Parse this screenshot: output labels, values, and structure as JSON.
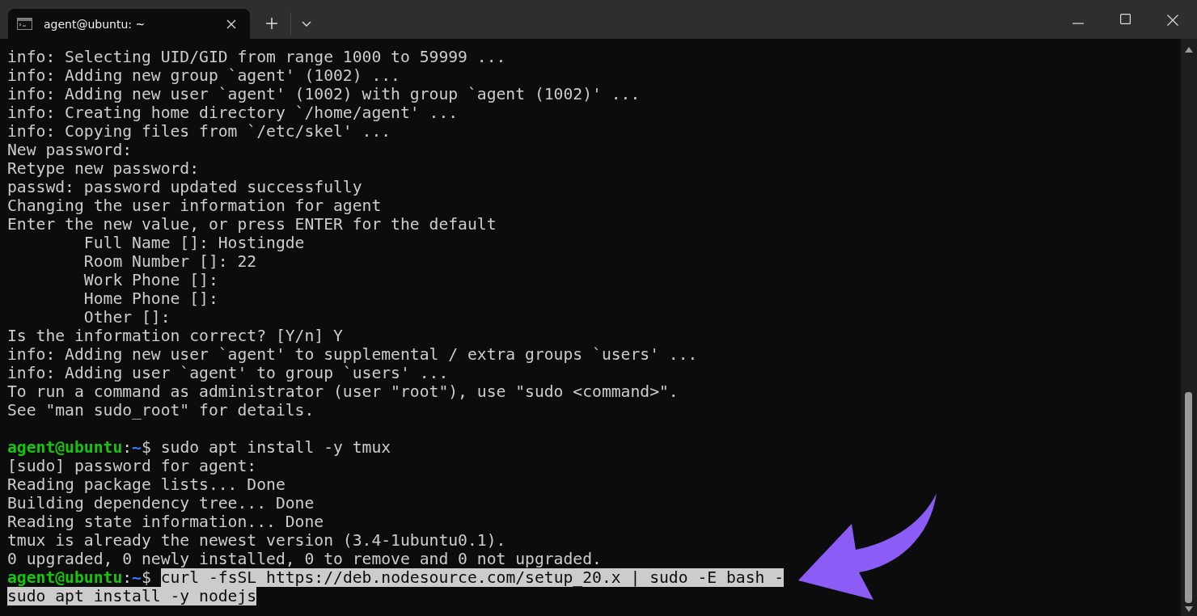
{
  "tab": {
    "title": "agent@ubuntu: ~",
    "selected": true
  },
  "lines": [
    {
      "kind": "text",
      "text": "info: Selecting UID/GID from range 1000 to 59999 ...",
      "selected": false
    },
    {
      "kind": "text",
      "text": "info: Adding new group `agent' (1002) ...",
      "selected": false
    },
    {
      "kind": "text",
      "text": "info: Adding new user `agent' (1002) with group `agent (1002)' ...",
      "selected": false
    },
    {
      "kind": "text",
      "text": "info: Creating home directory `/home/agent' ...",
      "selected": false
    },
    {
      "kind": "text",
      "text": "info: Copying files from `/etc/skel' ...",
      "selected": false
    },
    {
      "kind": "text",
      "text": "New password:",
      "selected": false
    },
    {
      "kind": "text",
      "text": "Retype new password:",
      "selected": false
    },
    {
      "kind": "text",
      "text": "passwd: password updated successfully",
      "selected": false
    },
    {
      "kind": "text",
      "text": "Changing the user information for agent",
      "selected": false
    },
    {
      "kind": "text",
      "text": "Enter the new value, or press ENTER for the default",
      "selected": false
    },
    {
      "kind": "text",
      "text": "        Full Name []: Hostingde",
      "selected": false
    },
    {
      "kind": "text",
      "text": "        Room Number []: 22",
      "selected": false
    },
    {
      "kind": "text",
      "text": "        Work Phone []:",
      "selected": false
    },
    {
      "kind": "text",
      "text": "        Home Phone []:",
      "selected": false
    },
    {
      "kind": "text",
      "text": "        Other []:",
      "selected": false
    },
    {
      "kind": "text",
      "text": "Is the information correct? [Y/n] Y",
      "selected": false
    },
    {
      "kind": "text",
      "text": "info: Adding new user `agent' to supplemental / extra groups `users' ...",
      "selected": false
    },
    {
      "kind": "text",
      "text": "info: Adding user `agent' to group `users' ...",
      "selected": false
    },
    {
      "kind": "text",
      "text": "To run a command as administrator (user \"root\"), use \"sudo <command>\".",
      "selected": false
    },
    {
      "kind": "text",
      "text": "See \"man sudo_root\" for details.",
      "selected": false
    },
    {
      "kind": "blank"
    },
    {
      "kind": "prompt",
      "user_host": "agent@ubuntu",
      "separator": ":",
      "path": "~",
      "symbol": "$",
      "command": "sudo apt install -y tmux",
      "selected": false
    },
    {
      "kind": "text",
      "text": "[sudo] password for agent:",
      "selected": false
    },
    {
      "kind": "text",
      "text": "Reading package lists... Done",
      "selected": false
    },
    {
      "kind": "text",
      "text": "Building dependency tree... Done",
      "selected": false
    },
    {
      "kind": "text",
      "text": "Reading state information... Done",
      "selected": false
    },
    {
      "kind": "text",
      "text": "tmux is already the newest version (3.4-1ubuntu0.1).",
      "selected": false
    },
    {
      "kind": "text",
      "text": "0 upgraded, 0 newly installed, 0 to remove and 0 not upgraded.",
      "selected": false
    },
    {
      "kind": "prompt",
      "user_host": "agent@ubuntu",
      "separator": ":",
      "path": "~",
      "symbol": "$",
      "command": "curl -fsSL https://deb.nodesource.com/setup_20.x | sudo -E bash -",
      "selected": true
    },
    {
      "kind": "text",
      "text": "sudo apt install -y nodejs",
      "selected": true
    }
  ]
}
